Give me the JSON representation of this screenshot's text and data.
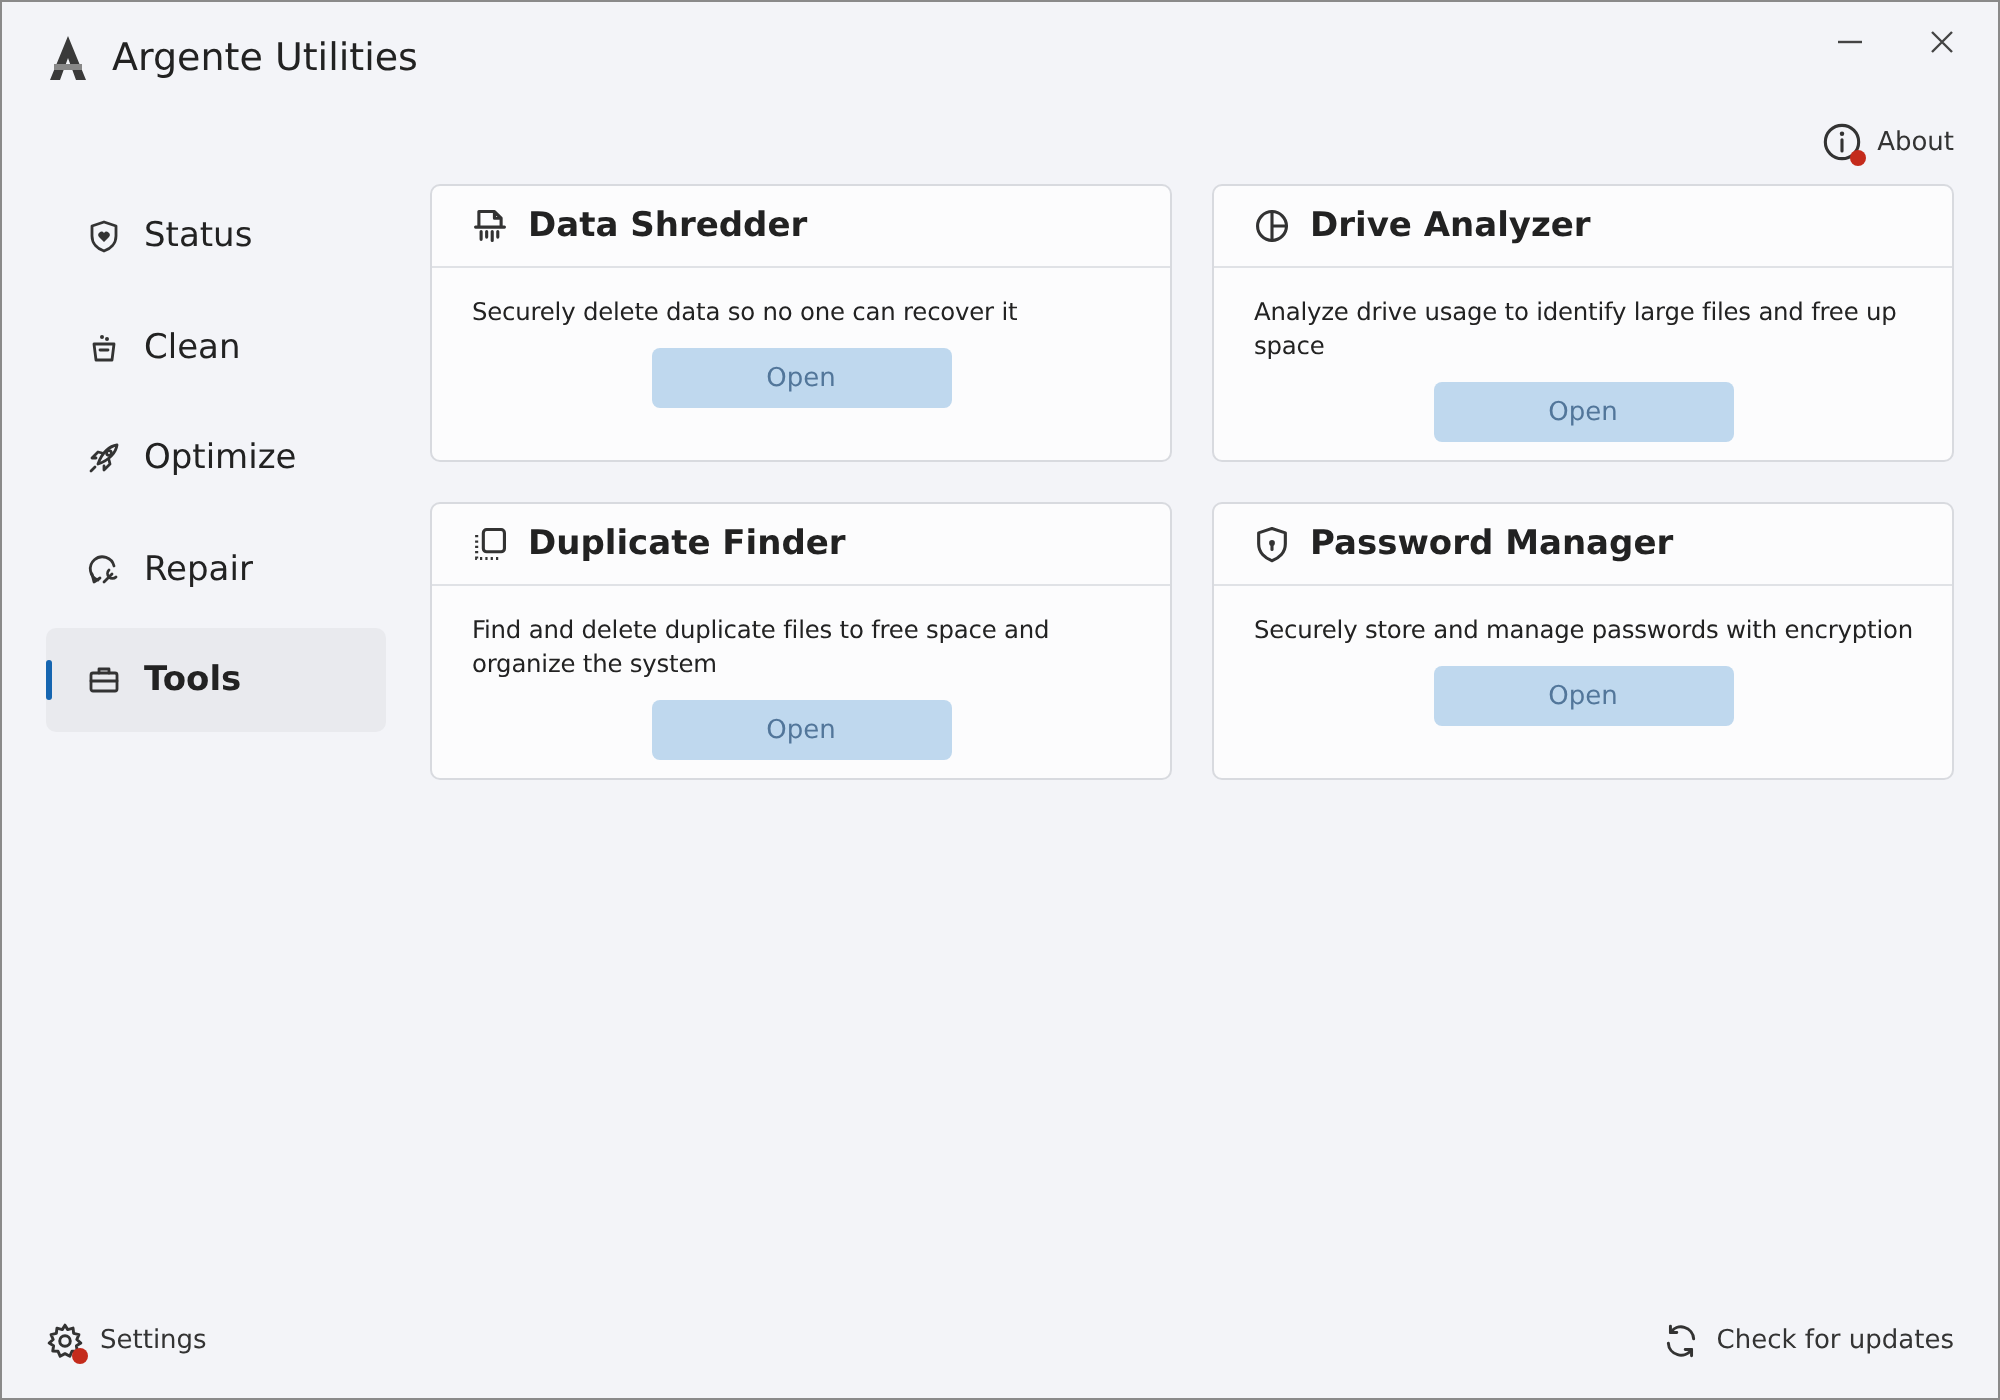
{
  "window": {
    "title": "Argente Utilities"
  },
  "about": {
    "label": "About",
    "notification": true
  },
  "sidebar": {
    "items": [
      {
        "label": "Status",
        "selected": false
      },
      {
        "label": "Clean",
        "selected": false
      },
      {
        "label": "Optimize",
        "selected": false
      },
      {
        "label": "Repair",
        "selected": false
      },
      {
        "label": "Tools",
        "selected": true
      }
    ]
  },
  "tools": [
    {
      "title": "Data Shredder",
      "description": "Securely delete data so no one can recover it",
      "button": "Open",
      "disabled": true
    },
    {
      "title": "Drive Analyzer",
      "description": "Analyze drive usage to identify large files and free up space",
      "button": "Open",
      "disabled": true
    },
    {
      "title": "Duplicate Finder",
      "description": "Find and delete duplicate files to free space and organize the system",
      "button": "Open",
      "disabled": true
    },
    {
      "title": "Password Manager",
      "description": "Securely store and manage passwords with encryption",
      "button": "Open",
      "disabled": true
    }
  ],
  "footer": {
    "settings": {
      "label": "Settings",
      "notification": true
    },
    "updates": {
      "label": "Check for updates"
    }
  }
}
